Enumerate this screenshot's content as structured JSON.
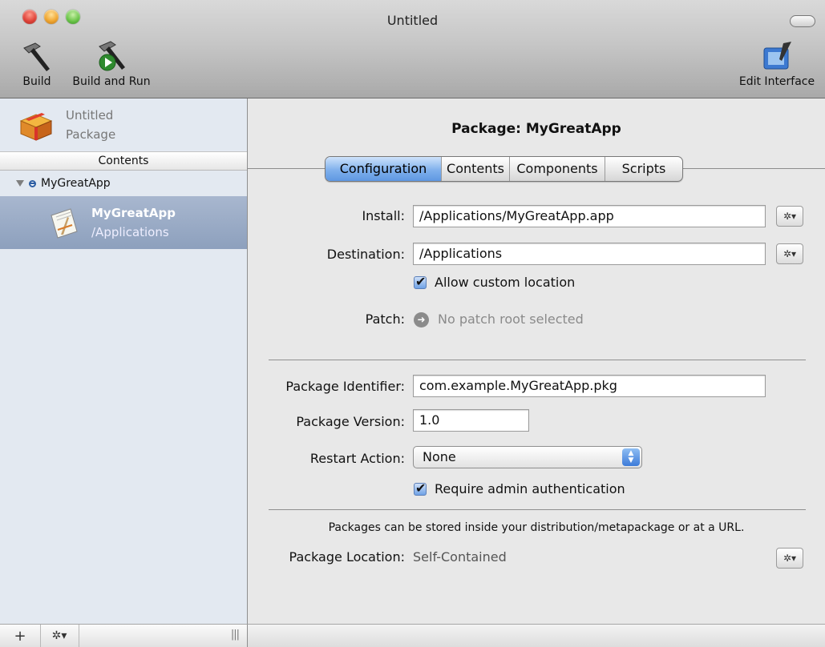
{
  "window": {
    "title": "Untitled"
  },
  "toolbar": {
    "build_label": "Build",
    "build_and_run_label": "Build and Run",
    "edit_interface_label": "Edit Interface"
  },
  "sidebar": {
    "project_name": "Untitled",
    "project_type": "Package",
    "contents_header": "Contents",
    "tree_root": "MyGreatApp",
    "selected_item": {
      "title": "MyGreatApp",
      "subtitle": "/Applications"
    }
  },
  "main": {
    "package_title": "Package: MyGreatApp",
    "tabs": [
      {
        "label": "Configuration",
        "active": true
      },
      {
        "label": "Contents"
      },
      {
        "label": "Components"
      },
      {
        "label": "Scripts"
      }
    ],
    "install": {
      "label": "Install:",
      "value": "/Applications/MyGreatApp.app"
    },
    "destination": {
      "label": "Destination:",
      "value": "/Applications"
    },
    "allow_custom_location": {
      "label": "Allow custom location",
      "checked": true
    },
    "patch": {
      "label": "Patch:",
      "value": "No patch root selected"
    },
    "package_identifier": {
      "label": "Package Identifier:",
      "value": "com.example.MyGreatApp.pkg"
    },
    "package_version": {
      "label": "Package Version:",
      "value": "1.0"
    },
    "restart_action": {
      "label": "Restart Action:",
      "value": "None"
    },
    "require_admin": {
      "label": "Require admin authentication",
      "checked": true
    },
    "location_note": "Packages can be stored inside your distribution/metapackage or at a URL.",
    "package_location": {
      "label": "Package Location:",
      "value": "Self-Contained"
    }
  },
  "colors": {
    "selection": "#8da0bd",
    "sidebar_bg": "#e3e9f1",
    "active_tab": "#7fb0ec"
  }
}
